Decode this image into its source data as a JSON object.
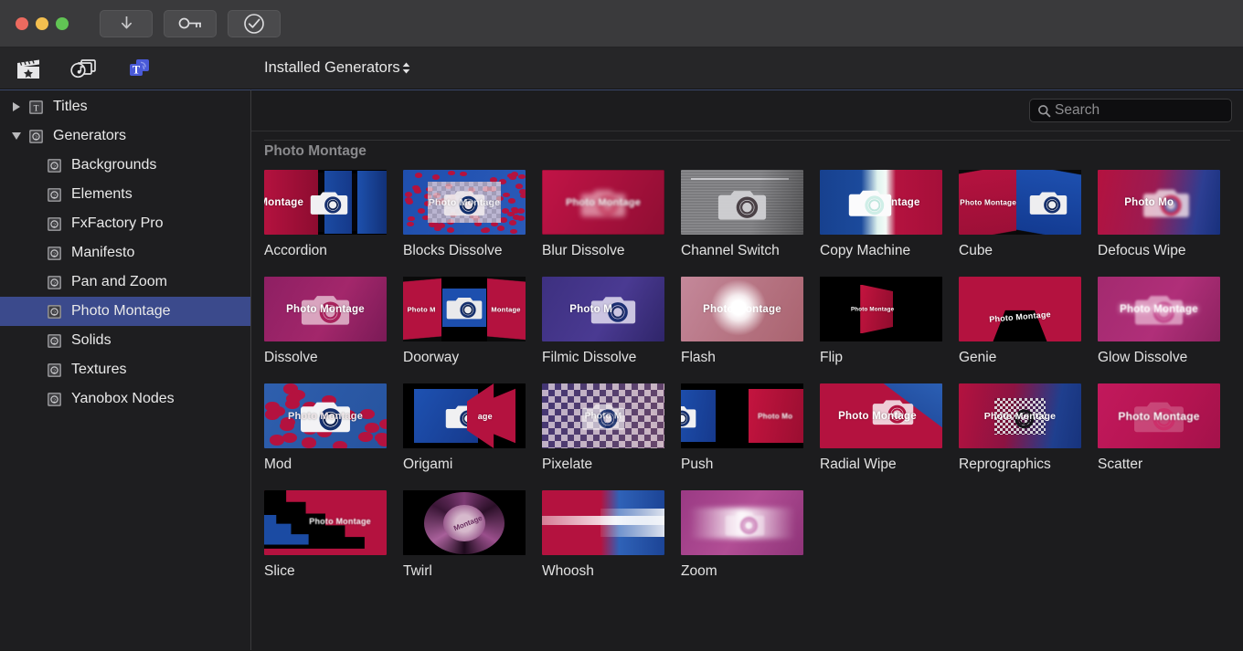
{
  "window": {
    "traffic_lights": [
      "close",
      "minimize",
      "zoom"
    ],
    "toolbar_buttons": [
      {
        "name": "download-button",
        "icon": "download-arrow-icon"
      },
      {
        "name": "key-button",
        "icon": "key-icon"
      },
      {
        "name": "check-button",
        "icon": "check-circle-icon"
      }
    ]
  },
  "tabbar": {
    "tabs": [
      {
        "name": "effects-tab",
        "icon": "clapperboard-icon",
        "active": false
      },
      {
        "name": "media-tab",
        "icon": "photos-music-icon",
        "active": false
      },
      {
        "name": "titles-generators-tab",
        "icon": "titles-t-icon",
        "active": true
      }
    ],
    "browser_title": "Installed Generators",
    "browser_chevron": "⇅"
  },
  "search": {
    "placeholder": "Search",
    "value": "",
    "icon": "search-icon"
  },
  "sidebar": {
    "items": [
      {
        "label": "Titles",
        "level": 0,
        "disclosure": "right",
        "icon": "title-t-icon",
        "selected": false
      },
      {
        "label": "Generators",
        "level": 0,
        "disclosure": "down",
        "icon": "generator-icon",
        "selected": false
      },
      {
        "label": "Backgrounds",
        "level": 1,
        "disclosure": "none",
        "icon": "generator-icon",
        "selected": false
      },
      {
        "label": "Elements",
        "level": 1,
        "disclosure": "none",
        "icon": "generator-icon",
        "selected": false
      },
      {
        "label": "FxFactory Pro",
        "level": 1,
        "disclosure": "none",
        "icon": "generator-icon",
        "selected": false
      },
      {
        "label": "Manifesto",
        "level": 1,
        "disclosure": "none",
        "icon": "generator-icon",
        "selected": false
      },
      {
        "label": "Pan and Zoom",
        "level": 1,
        "disclosure": "none",
        "icon": "generator-icon",
        "selected": false
      },
      {
        "label": "Photo Montage",
        "level": 1,
        "disclosure": "none",
        "icon": "generator-icon",
        "selected": true
      },
      {
        "label": "Solids",
        "level": 1,
        "disclosure": "none",
        "icon": "generator-icon",
        "selected": false
      },
      {
        "label": "Textures",
        "level": 1,
        "disclosure": "none",
        "icon": "generator-icon",
        "selected": false
      },
      {
        "label": "Yanobox Nodes",
        "level": 1,
        "disclosure": "none",
        "icon": "generator-icon",
        "selected": false
      }
    ]
  },
  "content": {
    "group_title": "Photo Montage",
    "thumb_caption_text": "Photo Montage",
    "items": [
      {
        "label": "Accordion",
        "style": "accordion"
      },
      {
        "label": "Blocks Dissolve",
        "style": "blocks"
      },
      {
        "label": "Blur Dissolve",
        "style": "blur"
      },
      {
        "label": "Channel Switch",
        "style": "channel"
      },
      {
        "label": "Copy Machine",
        "style": "copy"
      },
      {
        "label": "Cube",
        "style": "cube"
      },
      {
        "label": "Defocus Wipe",
        "style": "defocus"
      },
      {
        "label": "Dissolve",
        "style": "dissolve"
      },
      {
        "label": "Doorway",
        "style": "doorway"
      },
      {
        "label": "Filmic Dissolve",
        "style": "filmic"
      },
      {
        "label": "Flash",
        "style": "flash"
      },
      {
        "label": "Flip",
        "style": "flip"
      },
      {
        "label": "Genie",
        "style": "genie"
      },
      {
        "label": "Glow Dissolve",
        "style": "glow"
      },
      {
        "label": "Mod",
        "style": "mod"
      },
      {
        "label": "Origami",
        "style": "origami"
      },
      {
        "label": "Pixelate",
        "style": "pixelate"
      },
      {
        "label": "Push",
        "style": "push"
      },
      {
        "label": "Radial Wipe",
        "style": "radial"
      },
      {
        "label": "Reprographics",
        "style": "repro"
      },
      {
        "label": "Scatter",
        "style": "scatter"
      },
      {
        "label": "Slice",
        "style": "slice"
      },
      {
        "label": "Twirl",
        "style": "twirl"
      },
      {
        "label": "Whoosh",
        "style": "whoosh"
      },
      {
        "label": "Zoom",
        "style": "zoom"
      }
    ]
  },
  "colors": {
    "titlebar": "#3a3a3c",
    "tabbar": "#262628",
    "sidebar": "#1e1e20",
    "main": "#1c1c1e",
    "selection": "#3b4a8c",
    "accent_blue": "#4a5ad8",
    "crimson": "#b4123f",
    "deep_blue": "#17418f",
    "magenta": "#a3276b"
  }
}
